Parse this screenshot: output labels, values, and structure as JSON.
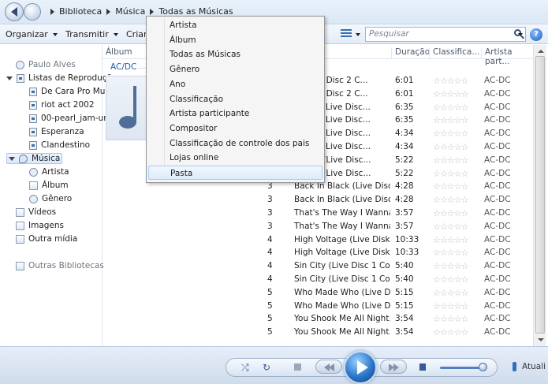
{
  "breadcrumb": [
    "Biblioteca",
    "Música",
    "Todas as Músicas"
  ],
  "toolbar": {
    "organize": "Organizar",
    "stream": "Transmitir",
    "create": "Criar",
    "search_placeholder": "Pesquisar"
  },
  "sidebar": {
    "user": "Paulo Alves",
    "playlists_label": "Listas de Reprodução",
    "playlists": [
      "De Cara Pro Mur",
      "riot act 2002",
      "00-pearl_jam-un",
      "Esperanza",
      "Clandestino"
    ],
    "music": "Música",
    "music_children": [
      "Artista",
      "Álbum",
      "Gênero"
    ],
    "videos": "Vídeos",
    "images": "Imagens",
    "other_media": "Outra mídia",
    "other_libraries": "Outras Bibliotecas"
  },
  "columns": {
    "album": "Álbum",
    "duration": "Duração",
    "rating": "Classifica...",
    "artist": "Artista part..."
  },
  "album_group": "AC/DC",
  "tracks": [
    {
      "disc": "",
      "title": "ls (Live Disc 2 C...",
      "duration": "6:01",
      "artist": "AC-DC"
    },
    {
      "disc": "",
      "title": "ls (Live Disc 2 C...",
      "duration": "6:01",
      "artist": "AC-DC"
    },
    {
      "disc": "",
      "title": "struck (Live Disc...",
      "duration": "6:35",
      "artist": "AC-DC"
    },
    {
      "disc": "",
      "title": "struck (Live Disc...",
      "duration": "6:35",
      "artist": "AC-DC"
    },
    {
      "disc": "",
      "title": "Ready (Live Disc...",
      "duration": "4:34",
      "artist": "AC-DC"
    },
    {
      "disc": "",
      "title": "Ready (Live Disc...",
      "duration": "4:34",
      "artist": "AC-DC"
    },
    {
      "disc": "",
      "title": "o Thril (Live Disc...",
      "duration": "5:22",
      "artist": "AC-DC"
    },
    {
      "disc": "",
      "title": "o Thril (Live Disc...",
      "duration": "5:22",
      "artist": "AC-DC"
    },
    {
      "disc": "3",
      "title": "Back In Black (Live Disc...",
      "duration": "4:28",
      "artist": "AC-DC"
    },
    {
      "disc": "3",
      "title": "Back In Black (Live Disc...",
      "duration": "4:28",
      "artist": "AC-DC"
    },
    {
      "disc": "3",
      "title": "That's The Way I Wanna...",
      "duration": "3:57",
      "artist": "AC-DC"
    },
    {
      "disc": "3",
      "title": "That's The Way I Wanna...",
      "duration": "3:57",
      "artist": "AC-DC"
    },
    {
      "disc": "4",
      "title": "High Voltage (Live Disk...",
      "duration": "10:33",
      "artist": "AC-DC"
    },
    {
      "disc": "4",
      "title": "High Voltage (Live Disk...",
      "duration": "10:33",
      "artist": "AC-DC"
    },
    {
      "disc": "4",
      "title": "Sin City (Live Disc 1 Coll...",
      "duration": "5:40",
      "artist": "AC-DC"
    },
    {
      "disc": "4",
      "title": "Sin City (Live Disc 1 Coll...",
      "duration": "5:40",
      "artist": "AC-DC"
    },
    {
      "disc": "5",
      "title": "Who Made Who (Live D...",
      "duration": "5:15",
      "artist": "AC-DC"
    },
    {
      "disc": "5",
      "title": "Who Made Who (Live D...",
      "duration": "5:15",
      "artist": "AC-DC"
    },
    {
      "disc": "5",
      "title": "You Shook Me All Night...",
      "duration": "3:54",
      "artist": "AC-DC"
    },
    {
      "disc": "5",
      "title": "You Shook Me All Night...",
      "duration": "3:54",
      "artist": "AC-DC"
    }
  ],
  "rating_stars": "☆☆☆☆☆",
  "menu": [
    "Artista",
    "Álbum",
    "Todas as Músicas",
    "Gênero",
    "Ano",
    "Classificação",
    "Artista participante",
    "Compositor",
    "Classificação de controle dos pais",
    "Lojas online",
    "Pasta"
  ],
  "menu_highlighted": "Pasta",
  "player": {
    "update_label": "Atuali"
  },
  "volume_fraction": 0.85,
  "colors": {
    "accent": "#1e5aa8",
    "highlight": "#dcebfc"
  }
}
